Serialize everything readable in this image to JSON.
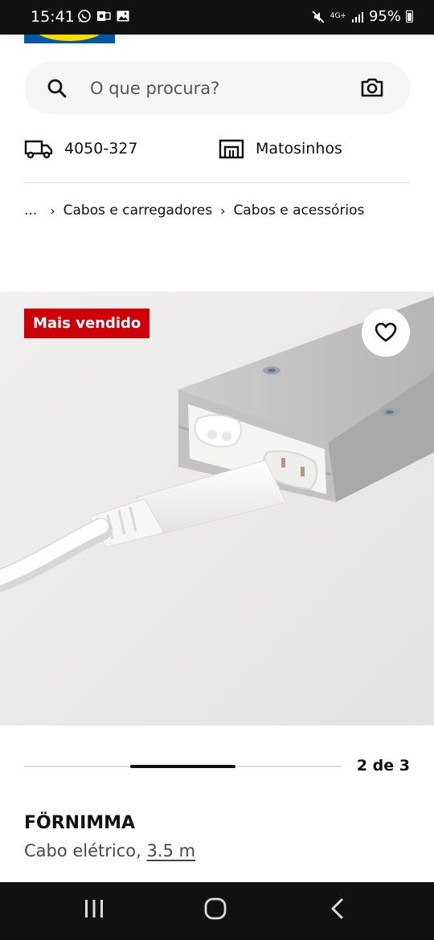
{
  "status_bar": {
    "time": "15:41",
    "network": "4G+",
    "battery": "95%",
    "icons": [
      "whatsapp-icon",
      "outlook-icon",
      "gallery-icon",
      "mute-icon",
      "signal-icon",
      "battery-icon"
    ]
  },
  "search": {
    "placeholder": "O que procura?",
    "icons": [
      "search-icon",
      "camera-icon"
    ]
  },
  "delivery": {
    "postal_code": "4050-327",
    "icon": "truck-icon"
  },
  "store": {
    "name": "Matosinhos",
    "icon": "store-icon"
  },
  "breadcrumb": {
    "ellipsis": "...",
    "items": [
      "Cabos e carregadores",
      "Cabos e acessórios"
    ]
  },
  "product_image": {
    "badge": "Mais vendido",
    "favourite_icon": "heart-icon"
  },
  "carousel": {
    "pager": "2 de 3",
    "current": 2,
    "total": 3
  },
  "product": {
    "name": "FÖRNIMMA",
    "description": "Cabo elétrico,",
    "length": "3.5 m"
  },
  "colors": {
    "badge": "#cc0008",
    "search_bg": "#f5f5f5",
    "brand_blue": "#0058a3",
    "brand_yellow": "#ffdb00"
  },
  "nav_bar": {
    "icons": [
      "recent-apps-icon",
      "home-icon",
      "back-icon"
    ]
  }
}
